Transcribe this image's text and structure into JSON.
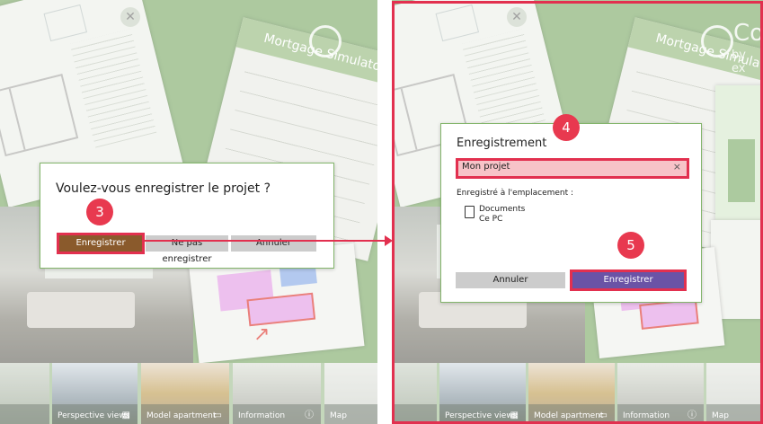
{
  "left_panel": {
    "mortgage_title": "Mortgage Simulator",
    "thumbnails": [
      "Perspective views",
      "Model apartment",
      "Information",
      "Map"
    ],
    "dialog": {
      "title": "Voulez-vous enregistrer le projet ?",
      "save_label": "Enregistrer",
      "dont_save_label": "Ne pas enregistrer",
      "cancel_label": "Annuler",
      "step_marker": "3"
    }
  },
  "right_panel": {
    "mortgage_title": "Mortgage Simulator",
    "logo_text": "Co",
    "logo_sub": "by ex",
    "thumbnails": [
      "Perspective views",
      "Model apartment",
      "Information",
      "Map"
    ],
    "dialog": {
      "title": "Enregistrement",
      "filename_value": "Mon projet",
      "clear_symbol": "×",
      "location_label": "Enregistré à l'emplacement :",
      "location_line1": "Documents",
      "location_line2": "Ce PC",
      "cancel_label": "Annuler",
      "save_label": "Enregistrer",
      "step_marker_input": "4",
      "step_marker_save": "5"
    }
  },
  "colors": {
    "highlight": "#e2304f",
    "save_left": "#8a5a2c",
    "save_right": "#6a53a6",
    "dialog_border": "#83b56b",
    "background_green": "#86b072"
  }
}
